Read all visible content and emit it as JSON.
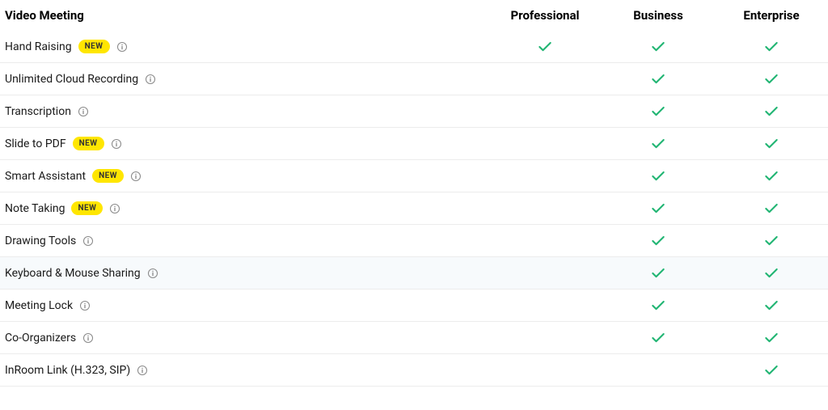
{
  "header": {
    "category": "Video Meeting",
    "plans": [
      "Professional",
      "Business",
      "Enterprise"
    ]
  },
  "badge_text": "NEW",
  "rows": [
    {
      "label": "Hand Raising",
      "badge": true,
      "info": true,
      "checks": [
        true,
        true,
        true
      ],
      "hover": false
    },
    {
      "label": "Unlimited Cloud Recording",
      "badge": false,
      "info": true,
      "checks": [
        false,
        true,
        true
      ],
      "hover": false
    },
    {
      "label": "Transcription",
      "badge": false,
      "info": true,
      "checks": [
        false,
        true,
        true
      ],
      "hover": false
    },
    {
      "label": "Slide to PDF",
      "badge": true,
      "info": true,
      "checks": [
        false,
        true,
        true
      ],
      "hover": false
    },
    {
      "label": "Smart Assistant",
      "badge": true,
      "info": true,
      "checks": [
        false,
        true,
        true
      ],
      "hover": false
    },
    {
      "label": "Note Taking",
      "badge": true,
      "info": true,
      "checks": [
        false,
        true,
        true
      ],
      "hover": false
    },
    {
      "label": "Drawing Tools",
      "badge": false,
      "info": true,
      "checks": [
        false,
        true,
        true
      ],
      "hover": false
    },
    {
      "label": "Keyboard & Mouse Sharing",
      "badge": false,
      "info": true,
      "checks": [
        false,
        true,
        true
      ],
      "hover": true
    },
    {
      "label": "Meeting Lock",
      "badge": false,
      "info": true,
      "checks": [
        false,
        true,
        true
      ],
      "hover": false
    },
    {
      "label": "Co-Organizers",
      "badge": false,
      "info": true,
      "checks": [
        false,
        true,
        true
      ],
      "hover": false
    },
    {
      "label": "InRoom Link (H.323, SIP)",
      "badge": false,
      "info": true,
      "checks": [
        false,
        false,
        true
      ],
      "hover": false
    }
  ]
}
